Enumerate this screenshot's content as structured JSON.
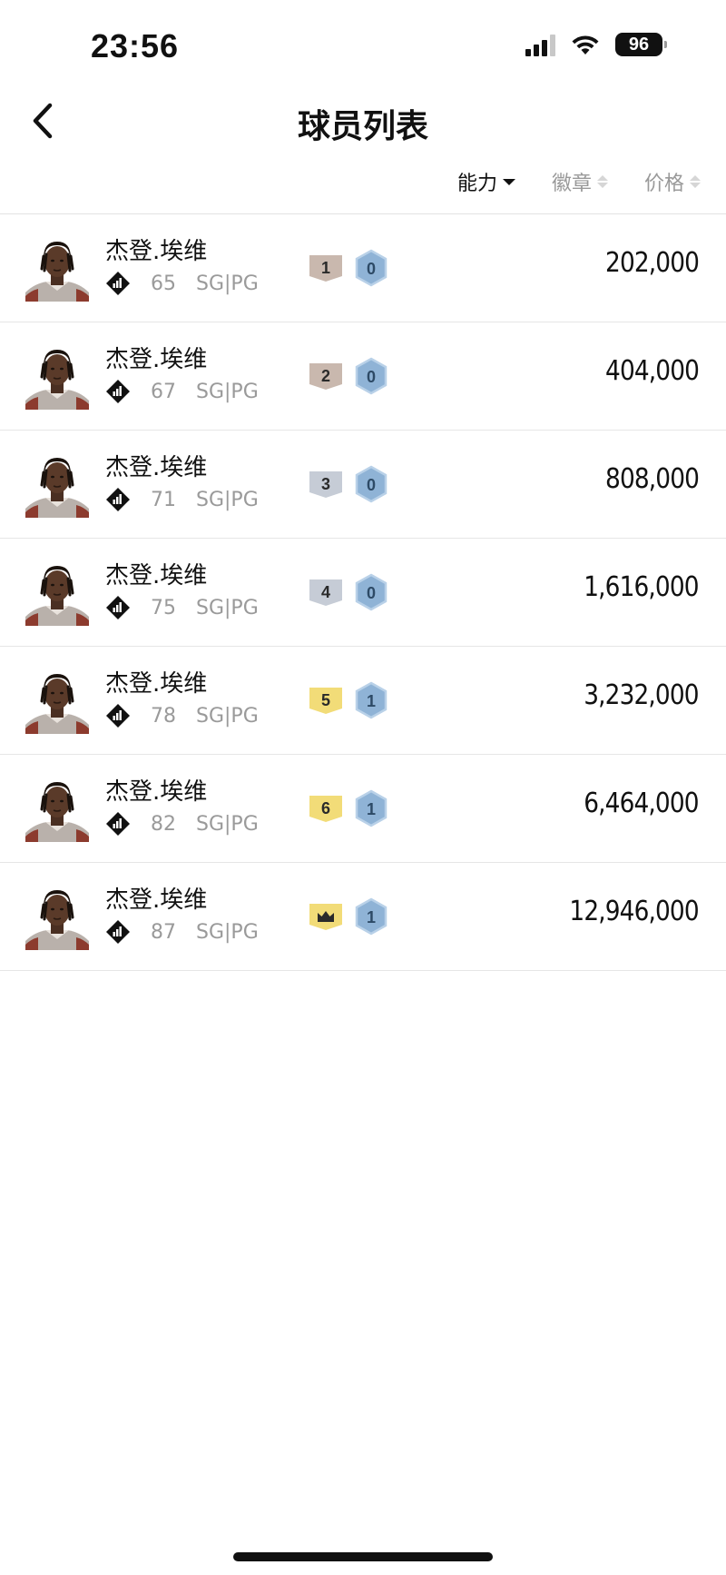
{
  "status_bar": {
    "time": "23:56",
    "battery": "96"
  },
  "header": {
    "title": "球员列表"
  },
  "sort": {
    "ability": "能力",
    "badges": "徽章",
    "price": "价格"
  },
  "players": [
    {
      "name": "杰登.埃维",
      "rating": "65",
      "position": "SG|PG",
      "level": "1",
      "badge": "0",
      "price": "202,000",
      "level_color": "#c9b8ae"
    },
    {
      "name": "杰登.埃维",
      "rating": "67",
      "position": "SG|PG",
      "level": "2",
      "badge": "0",
      "price": "404,000",
      "level_color": "#c9b8ae"
    },
    {
      "name": "杰登.埃维",
      "rating": "71",
      "position": "SG|PG",
      "level": "3",
      "badge": "0",
      "price": "808,000",
      "level_color": "#c6ccd6"
    },
    {
      "name": "杰登.埃维",
      "rating": "75",
      "position": "SG|PG",
      "level": "4",
      "badge": "0",
      "price": "1,616,000",
      "level_color": "#c6ccd6"
    },
    {
      "name": "杰登.埃维",
      "rating": "78",
      "position": "SG|PG",
      "level": "5",
      "badge": "1",
      "price": "3,232,000",
      "level_color": "#f2dc78"
    },
    {
      "name": "杰登.埃维",
      "rating": "82",
      "position": "SG|PG",
      "level": "6",
      "badge": "1",
      "price": "6,464,000",
      "level_color": "#f2dc78"
    },
    {
      "name": "杰登.埃维",
      "rating": "87",
      "position": "SG|PG",
      "level": "",
      "level_icon": "crown-icon",
      "badge": "1",
      "price": "12,946,000",
      "level_color": "#f2dc78"
    }
  ],
  "colors": {
    "badge_blue": "#8fb3d6",
    "badge_blue_border": "#6e94bb",
    "divider": "#e6e6e6",
    "muted_text": "#9a9a9a"
  }
}
